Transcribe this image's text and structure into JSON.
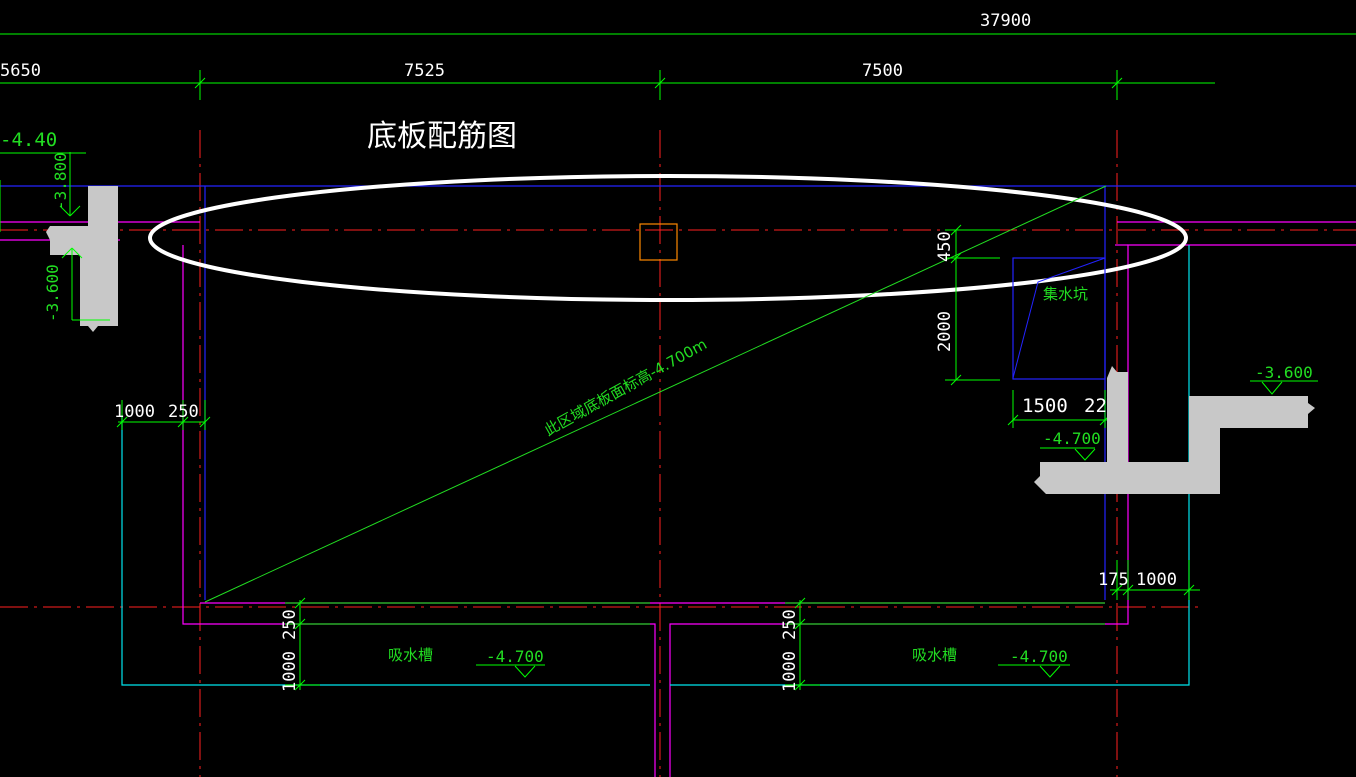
{
  "drawing": {
    "title": "底板配筋图",
    "colors": {
      "background": "#000000",
      "dimension": "#00ff00",
      "axis": "#ff2020",
      "wall_magenta": "#ff00ff",
      "slab_cyan": "#00e5ee",
      "blue": "#2323ff",
      "concrete_fill": "#c8c8c8",
      "highlight_ellipse": "#ffffff",
      "column_marker": "#ff8800"
    },
    "dimensions": {
      "overall": "37900",
      "span_left": "5650",
      "span_mid": "7525",
      "span_right": "7500",
      "left_offset_1000": "1000",
      "left_offset_250": "250",
      "pit_450": "450",
      "pit_2000": "2000",
      "pit_1500": "1500",
      "pit_225": "225",
      "right_175": "175",
      "right_1000": "1000",
      "bottom_250_a": "250",
      "bottom_1000_a": "1000",
      "bottom_250_b": "250",
      "bottom_1000_b": "1000"
    },
    "levels": {
      "top_left": "-4.40",
      "left_upper": "-3.800",
      "left_lower": "-3.600",
      "right_upper": "-3.600",
      "right_lower": "-4.700",
      "bottom_a": "-4.700",
      "bottom_b": "-4.700"
    },
    "labels": {
      "sump_pit": "集水坑",
      "trench_a": "吸水槽",
      "trench_b": "吸水槽",
      "diagonal_note": "此区域底板面标高-4.700m"
    }
  }
}
